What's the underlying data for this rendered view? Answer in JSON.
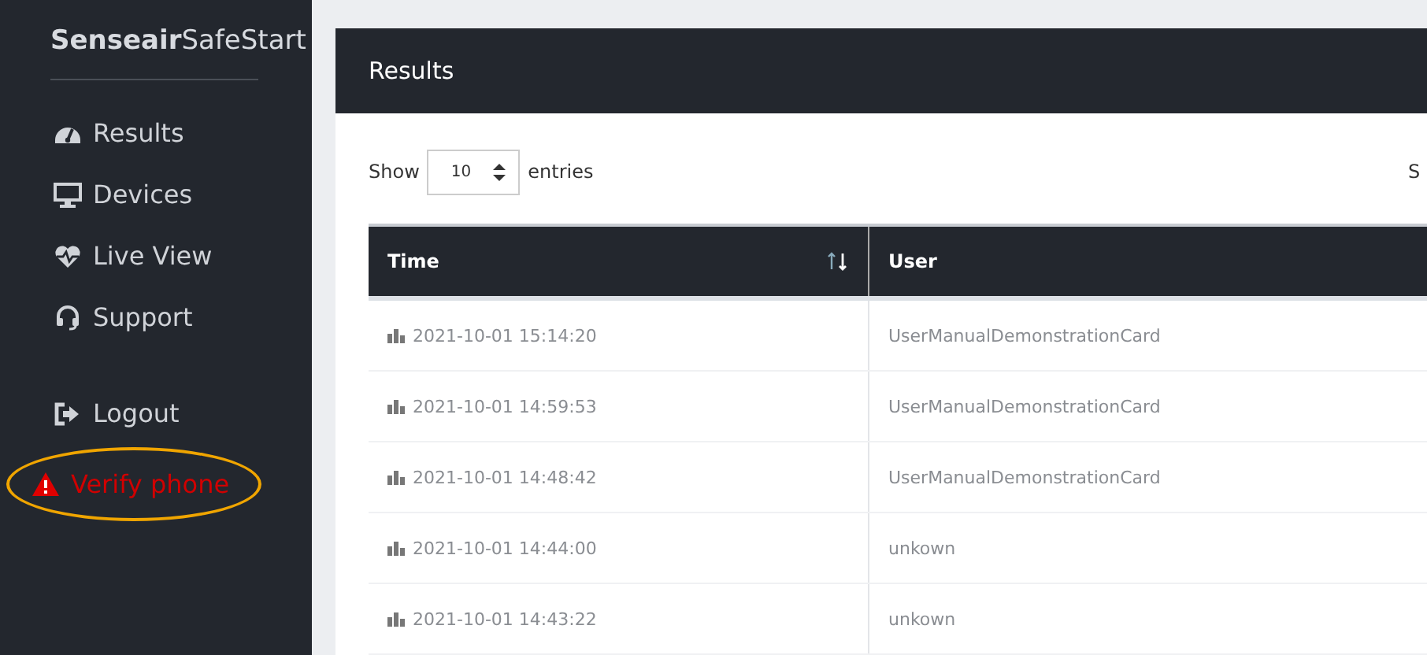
{
  "brand": "**Senseair**SafeStart",
  "nav": [
    {
      "label": "Results"
    },
    {
      "label": "Devices"
    },
    {
      "label": "Live View"
    },
    {
      "label": "Support"
    }
  ],
  "secondary_nav": [
    {
      "label": "Logout",
      "kind": "normal"
    },
    {
      "label": "Verify phone",
      "kind": "alert"
    }
  ],
  "page_title": "Results",
  "length_menu": {
    "before": "Show",
    "value": "10",
    "after": "entries"
  },
  "search_label": "S",
  "table": {
    "columns": [
      {
        "label": "Time",
        "sortable": true
      },
      {
        "label": "User",
        "sortable": false
      }
    ],
    "rows": [
      {
        "time": "2021-10-01 15:14:20",
        "user": "UserManualDemonstrationCard"
      },
      {
        "time": "2021-10-01 14:59:53",
        "user": "UserManualDemonstrationCard"
      },
      {
        "time": "2021-10-01 14:48:42",
        "user": "UserManualDemonstrationCard"
      },
      {
        "time": "2021-10-01 14:44:00",
        "user": "unkown"
      },
      {
        "time": "2021-10-01 14:43:22",
        "user": "unkown"
      }
    ]
  }
}
